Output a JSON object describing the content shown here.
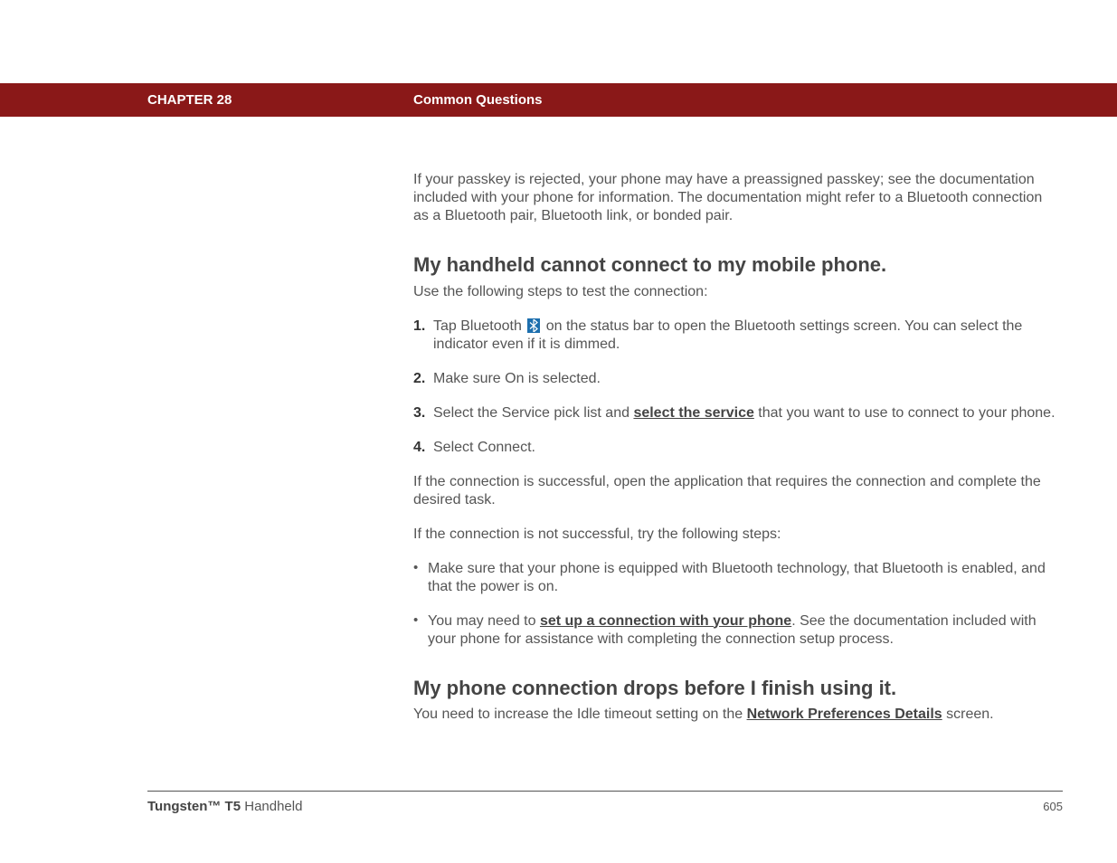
{
  "header": {
    "chapter": "CHAPTER 28",
    "title": "Common Questions"
  },
  "content": {
    "intro_para": "If your passkey is rejected, your phone may have a preassigned passkey; see the documentation included with your phone for information. The documentation might refer to a Bluetooth connection as a Bluetooth pair, Bluetooth link, or bonded pair.",
    "heading1": "My handheld cannot connect to my mobile phone.",
    "heading1_sub": "Use the following steps to test the connection:",
    "steps": [
      {
        "num": "1.",
        "text_before": "Tap Bluetooth ",
        "text_after": " on the status bar to open the Bluetooth settings screen. You can select the indicator even if it is dimmed."
      },
      {
        "num": "2.",
        "text": "Make sure On is selected."
      },
      {
        "num": "3.",
        "text_before": "Select the Service pick list and ",
        "link": "select the service",
        "text_after": " that you want to use to connect to your phone."
      },
      {
        "num": "4.",
        "text": "Select Connect."
      }
    ],
    "success_para": "If the connection is successful, open the application that requires the connection and complete the desired task.",
    "fail_para": "If the connection is not successful, try the following steps:",
    "bullets": [
      {
        "text": "Make sure that your phone is equipped with Bluetooth technology, that Bluetooth is enabled, and that the power is on."
      },
      {
        "text_before": "You may need to ",
        "link": "set up a connection with your phone",
        "text_after": ". See the documentation included with your phone for assistance with completing the connection setup process."
      }
    ],
    "heading2": "My phone connection drops before I finish using it.",
    "heading2_text_before": "You need to increase the Idle timeout setting on the ",
    "heading2_link": "Network Preferences Details",
    "heading2_text_after": " screen."
  },
  "footer": {
    "product_bold": "Tungsten™ T5",
    "product_rest": " Handheld",
    "page": "605"
  }
}
